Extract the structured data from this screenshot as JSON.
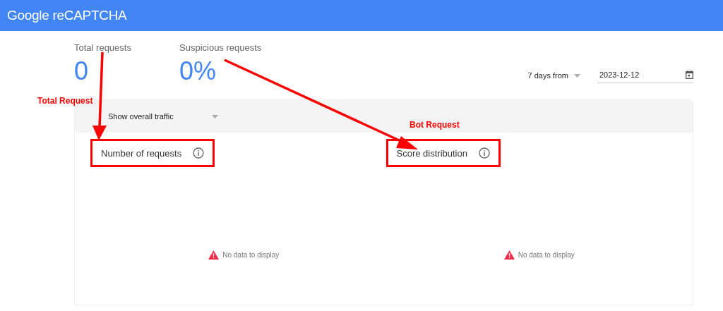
{
  "header": {
    "title": "Google reCAPTCHA"
  },
  "stats": [
    {
      "label": "Total requests",
      "value": "0"
    },
    {
      "label": "Suspicious requests",
      "value": "0%"
    }
  ],
  "date_range": {
    "label": "7 days from",
    "value": "2023-12-12"
  },
  "card": {
    "filter": "Show overall traffic",
    "panels": [
      {
        "title": "Number of requests",
        "highlighted": true,
        "message": "No data to display"
      },
      {
        "title": "Score distribution",
        "highlighted": true,
        "message": "No data to display"
      }
    ]
  },
  "annotations": [
    {
      "text": "Total Request"
    },
    {
      "text": "Bot Request"
    }
  ]
}
